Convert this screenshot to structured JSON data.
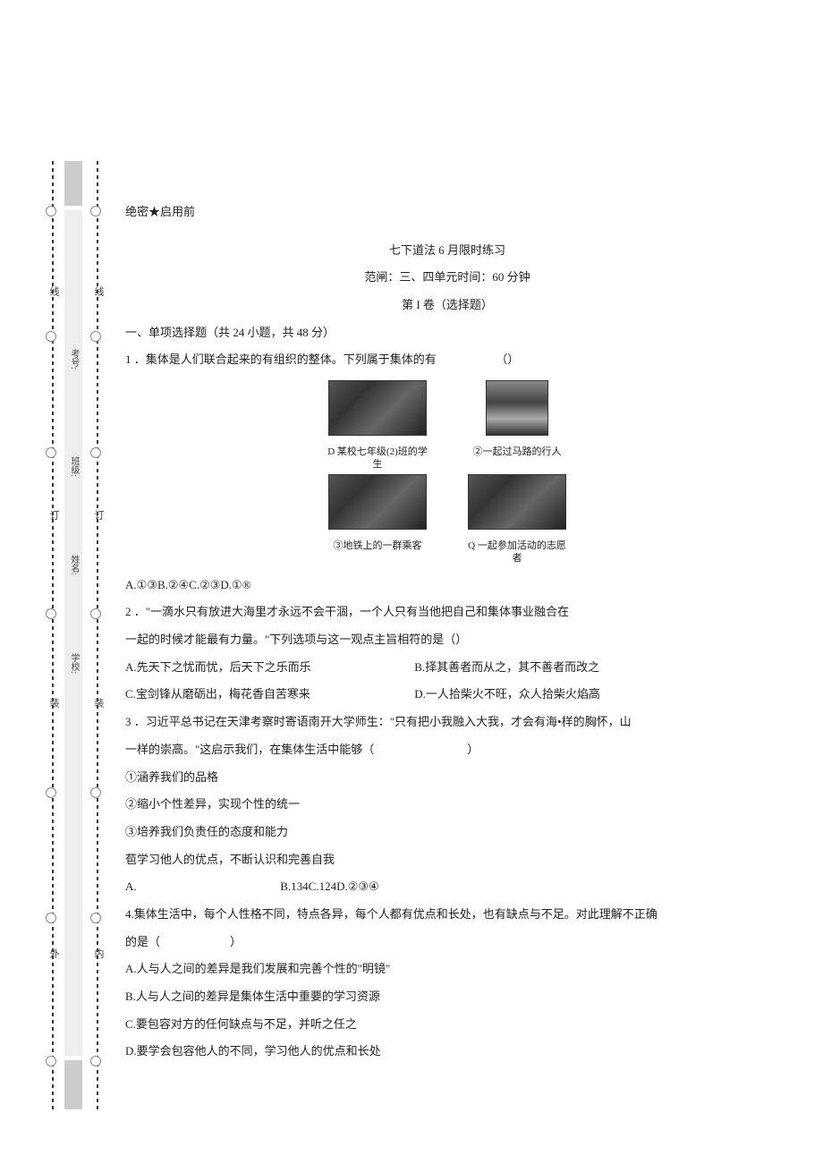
{
  "secret": "绝密★启用前",
  "title": "七下道法 6 月限时练习",
  "scope": "范闸：三、四单元时间：60 分钟",
  "part": "第 I 卷（选择题）",
  "section": "一、单项选择题（共 24 小题，共 48 分）",
  "q1": {
    "stem": "1 ．集体是人们联合起来的有组织的整体。下列属于集体的有",
    "paren": "（）",
    "img1": "D 某校七年级(2)班的学生",
    "img2": "②一起过马路的行人",
    "img3": "③地铁上的一群乘客",
    "img4": "Q 一起参加活动的志愿者",
    "opts": "A.①③B.②④C.②③D.①®"
  },
  "q2": {
    "l1": "2 ．\"一滴水只有放进大海里才永远不会干涸，一个人只有当他把自己和集体事业融合在",
    "l2": "一起的时候才能最有力量。\"下列选项与这一观点主旨相符的是（）",
    "a": "A.先天下之忧而忧，后天下之乐而乐",
    "b": "B.择其善者而从之，其不善者而改之",
    "c": "C.宝剑锋从磨砺出，梅花香自苦寒来",
    "d": "D.一人拾柴火不旺，众人拾柴火焰高"
  },
  "q3": {
    "l1": "3 ．习近平总书记在天津考察时寄语南开大学师生：\"只有把小我融入大我，才会有海•样的胸怀，山",
    "l2": "一样的崇高。\"这启示我们，在集体生活中能够（　　　　　　　　）",
    "o1": "①涵养我们的品格",
    "o2": "②缩小个性差异，实现个性的统一",
    "o3": "③培养我们负责任的态度和能力",
    "o4": "苞学习他人的优点，不断认识和完善自我",
    "opts_a": "A.",
    "opts_b": "B.134C.124D.②③④"
  },
  "q4": {
    "l1": "4.集体生活中，每个人性格不同，特点各异，每个人都有优点和长处，也有缺点与不足。对此理解不正确",
    "l2": "的是（　　　　　　）",
    "a": "A.人与人之间的差异是我们发展和完善个性的\"明镜\"",
    "b": "B.人与人之间的差异是集体生活中重要的学习资源",
    "c": "C.要包容对方的任何缺点与不足，并听之任之",
    "d": "D.要学会包容他人的不同，学习他人的优点和长处"
  },
  "margin": {
    "outer": "外",
    "outer_zhuang": "装",
    "outer_ding": "订",
    "outer_xian": "线",
    "inner": "内",
    "inner_zhuang": "装",
    "inner_ding": "订",
    "inner_xian": "线",
    "school": "学校:",
    "name": "姓名:",
    "class": "班级:",
    "examno": "考号:"
  }
}
